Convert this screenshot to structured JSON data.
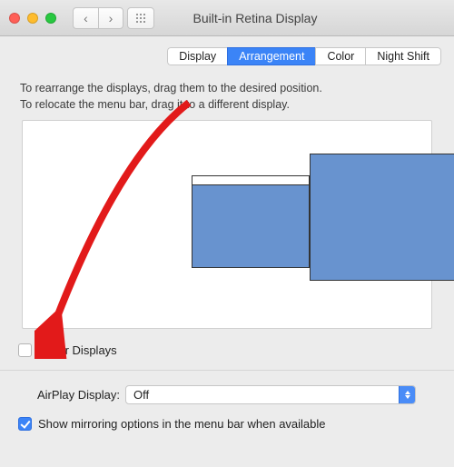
{
  "window": {
    "title": "Built-in Retina Display"
  },
  "tabs": [
    {
      "label": "Display",
      "active": false
    },
    {
      "label": "Arrangement",
      "active": true
    },
    {
      "label": "Color",
      "active": false
    },
    {
      "label": "Night Shift",
      "active": false
    }
  ],
  "hints": {
    "line1": "To rearrange the displays, drag them to the desired position.",
    "line2": "To relocate the menu bar, drag it to a different display."
  },
  "mirror_checkbox": {
    "label": "Mirror Displays",
    "checked": false
  },
  "airplay": {
    "label": "AirPlay Display:",
    "value": "Off"
  },
  "show_mirror_options": {
    "label": "Show mirroring options in the menu bar when available",
    "checked": true
  },
  "annotation": {
    "arrow_color": "#e21a1a"
  }
}
